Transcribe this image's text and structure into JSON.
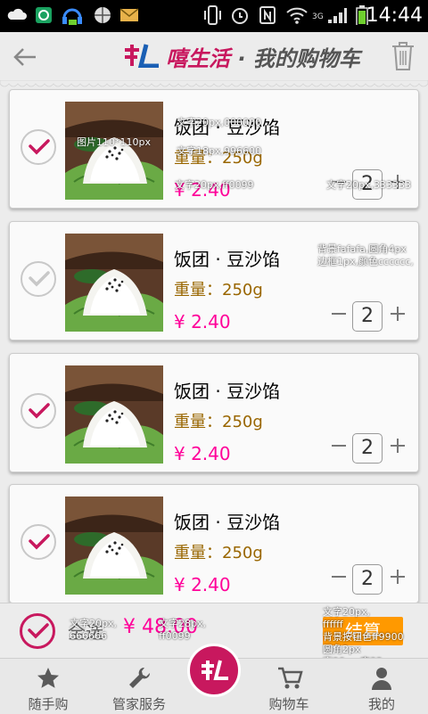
{
  "status_bar": {
    "time": "14:44",
    "network": "3G"
  },
  "header": {
    "brand": "嘻生活",
    "separator": "·",
    "title": "我的购物车"
  },
  "items": [
    {
      "name": "饭团 · 豆沙馅",
      "weight": "重量：250g",
      "price": "¥ 2.40",
      "qty": "2",
      "checked": true
    },
    {
      "name": "饭团 · 豆沙馅",
      "weight": "重量：250g",
      "price": "¥ 2.40",
      "qty": "2",
      "checked": false
    },
    {
      "name": "饭团 · 豆沙馅",
      "weight": "重量：250g",
      "price": "¥ 2.40",
      "qty": "2",
      "checked": true
    },
    {
      "name": "饭团 · 豆沙馅",
      "weight": "重量：250g",
      "price": "¥ 2.40",
      "qty": "2",
      "checked": true
    }
  ],
  "annotations": {
    "name_spec": "文字20px,000000",
    "image_spec": "图片110*110px",
    "weight_spec": "文字18px,996600",
    "price_spec": "文字20px,ff0099",
    "qty_spec": "文字20px,333333",
    "card_spec": "背景fafafa,圆角4px\n边框1px,颜色cccccc,",
    "label_spec": "文字20px,\n666666",
    "total_spec": "文字28px,\nff0099",
    "button_spec": "文字20px,\nffffff\n背景按钮色ff9900\n圆角2px\n宽90px,高32px"
  },
  "checkout": {
    "select_all_label": "全选",
    "total": "¥ 48.00",
    "button": "结算"
  },
  "tabs": [
    {
      "label": "随手购",
      "icon": "star-icon"
    },
    {
      "label": "管家服务",
      "icon": "wrench-icon"
    },
    {
      "label": "",
      "icon": "home-logo-icon"
    },
    {
      "label": "购物车",
      "icon": "cart-icon"
    },
    {
      "label": "我的",
      "icon": "user-icon"
    }
  ],
  "colors": {
    "brand": "#c8185e",
    "price": "#ff0099",
    "weight": "#996600",
    "button": "#ff9900",
    "card_bg": "#fafafa",
    "card_border": "#cccccc"
  }
}
